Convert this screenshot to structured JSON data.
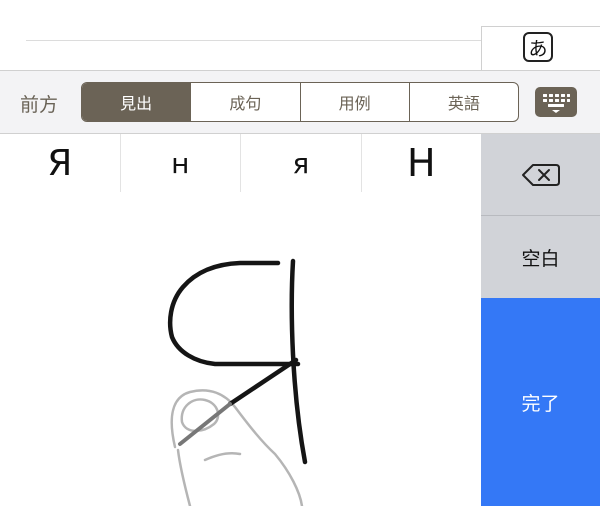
{
  "kana_button": {
    "label": "あ"
  },
  "toolbar": {
    "prev_label": "前方",
    "tabs": [
      {
        "label": "見出",
        "active": true
      },
      {
        "label": "成句",
        "active": false
      },
      {
        "label": "用例",
        "active": false
      },
      {
        "label": "英語",
        "active": false
      }
    ],
    "keyboard_icon": "keyboard-icon"
  },
  "candidates": [
    "Я",
    "н",
    "я",
    "Н"
  ],
  "sidebar": {
    "delete_icon": "backspace-icon",
    "space_label": "空白",
    "done_label": "完了"
  },
  "colors": {
    "accent_brown": "#6b6356",
    "done_blue": "#3478f6",
    "side_gray": "#d1d3d8"
  }
}
